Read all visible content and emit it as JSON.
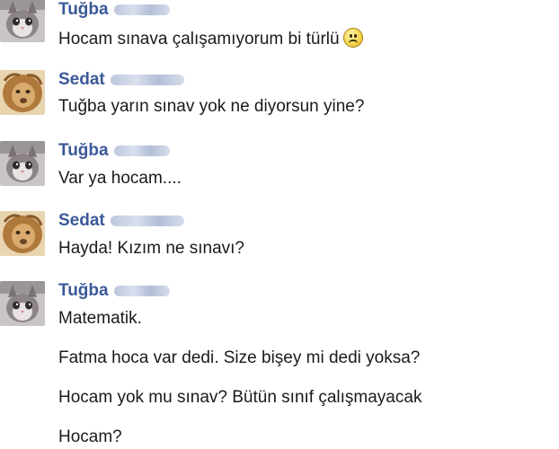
{
  "users": {
    "tugba": {
      "name": "Tuğba"
    },
    "sedat": {
      "name": "Sedat"
    }
  },
  "messages": [
    {
      "sender": "Tuğba",
      "lines": [
        "Hocam sınava çalışamıyorum bi türlü"
      ],
      "emoji": "sad-face-icon"
    },
    {
      "sender": "Sedat",
      "lines": [
        "Tuğba yarın sınav yok ne diyorsun yine?"
      ]
    },
    {
      "sender": "Tuğba",
      "lines": [
        "Var ya hocam...."
      ]
    },
    {
      "sender": "Sedat",
      "lines": [
        "Hayda! Kızım ne sınavı?"
      ]
    },
    {
      "sender": "Tuğba",
      "lines": [
        "Matematik.",
        "Fatma hoca var dedi. Size bişey mi dedi yoksa?",
        "Hocam yok mu sınav? Bütün sınıf çalışmayacak",
        "Hocam?"
      ]
    }
  ],
  "colors": {
    "name": "#3b5998",
    "text": "#1a1a1a",
    "background": "#ffffff"
  }
}
